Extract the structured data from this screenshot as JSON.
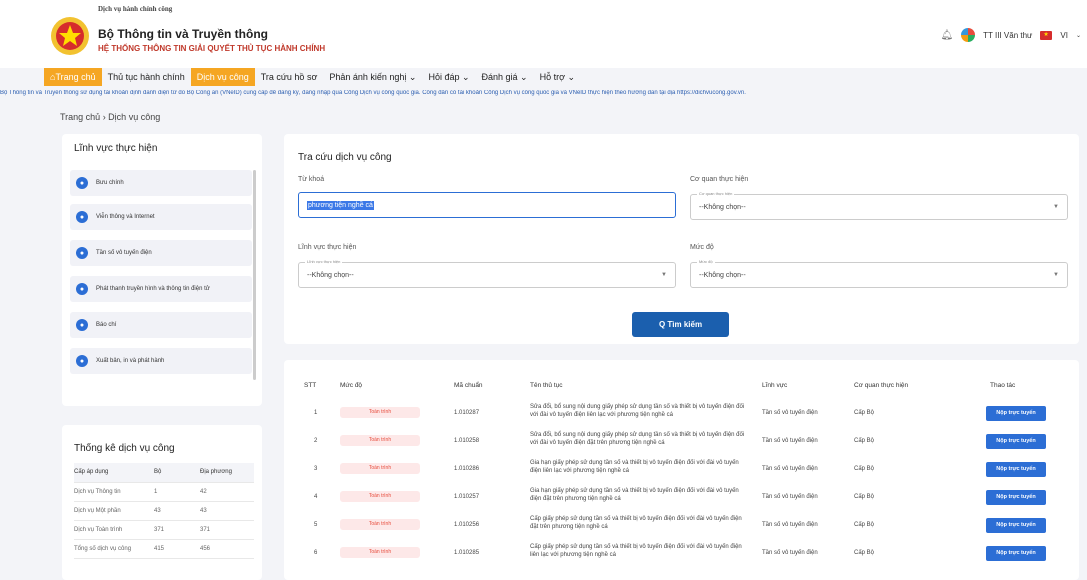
{
  "header": {
    "brand_small": "Dịch vụ hành chính công",
    "brand_big": "Bộ Thông tin và Truyền thông",
    "brand_sub": "HỆ THỐNG THÔNG TIN GIẢI QUYẾT THỦ TỤC HÀNH CHÍNH",
    "user": "TT III Văn thư",
    "lang": "VI"
  },
  "nav": [
    {
      "label": "Trang chủ",
      "active": true
    },
    {
      "label": "Thủ tục hành chính",
      "active": false
    },
    {
      "label": "Dịch vụ công",
      "active": true
    },
    {
      "label": "Tra cứu hồ sơ",
      "active": false
    },
    {
      "label": "Phản ánh kiến nghị ⌄",
      "active": false
    },
    {
      "label": "Hỏi đáp ⌄",
      "active": false
    },
    {
      "label": "Đánh giá ⌄",
      "active": false
    },
    {
      "label": "Hỗ trợ ⌄",
      "active": false
    }
  ],
  "notice": "Bộ Thông tin và Truyền thông sử dụng tài khoản định danh điện tử do Bộ Công an (VNeID) cung cấp để đăng ký, đăng nhập qua Cổng Dịch vụ công quốc gia. Công dân có tài khoản Cổng Dịch vụ công quốc gia và VNeID thực hiện theo hướng dẫn tại địa https://dichvucong.gov.vn.",
  "breadcrumb": "Trang chủ  ›  Dịch vụ công",
  "fields_card": {
    "title": "Lĩnh vực thực hiện",
    "items": [
      "Bưu chính",
      "Viễn thông và Internet",
      "Tần số vô tuyến điện",
      "Phát thanh truyền hình và thông tin điện tử",
      "Báo chí",
      "Xuất bản, in và phát hành"
    ]
  },
  "stats": {
    "title": "Thống kê dịch vụ công",
    "header": [
      "Cấp áp dụng",
      "Bộ",
      "Địa phương"
    ],
    "rows": [
      [
        "Dịch vụ Thông tin",
        "1",
        "42"
      ],
      [
        "Dịch vụ Một phần",
        "43",
        "43"
      ],
      [
        "Dịch vụ Toàn trình",
        "371",
        "371"
      ],
      [
        "Tổng số dịch vụ công",
        "415",
        "456"
      ]
    ]
  },
  "search": {
    "title": "Tra cứu dịch vụ công",
    "keyword_label": "Từ khoá",
    "keyword_value": "phương tiện nghề cá",
    "agency_label": "Cơ quan thực hiện",
    "agency_mini": "Cơ quan thực hiện",
    "agency_value": "--Không chọn--",
    "field_label": "Lĩnh vực thực hiện",
    "field_mini": "Lĩnh vực thực hiện",
    "field_value": "--Không chọn--",
    "level_label": "Mức độ",
    "level_mini": "Mức độ",
    "level_value": "--Không chọn--",
    "button": "Q  Tìm kiếm"
  },
  "table": {
    "headers": [
      "STT",
      "Mức độ",
      "Mã chuẩn",
      "Tên thủ tục",
      "Lĩnh vực",
      "Cơ quan thực hiện",
      "Thao tác"
    ],
    "rows": [
      {
        "stt": "1",
        "level": "Toàn trình",
        "code": "1.010287",
        "name": "Sửa đổi, bổ sung nội dung giấy phép sử dụng tần số và thiết bị vô tuyến điện đối với đài vô tuyến điện liên lạc với phương tiện nghề cá",
        "field": "Tần số vô tuyến điện",
        "org": "Cấp Bộ",
        "action": "Nộp trực tuyến"
      },
      {
        "stt": "2",
        "level": "Toàn trình",
        "code": "1.010258",
        "name": "Sửa đổi, bổ sung nội dung giấy phép sử dụng tần số và thiết bị vô tuyến điện đối với đài vô tuyến điện đặt trên phương tiện nghề cá",
        "field": "Tần số vô tuyến điện",
        "org": "Cấp Bộ",
        "action": "Nộp trực tuyến"
      },
      {
        "stt": "3",
        "level": "Toàn trình",
        "code": "1.010286",
        "name": "Gia hạn giấy phép sử dụng tần số và thiết bị vô tuyến điện đối với đài vô tuyến điện liên lạc với phương tiện nghề cá",
        "field": "Tần số vô tuyến điện",
        "org": "Cấp Bộ",
        "action": "Nộp trực tuyến"
      },
      {
        "stt": "4",
        "level": "Toàn trình",
        "code": "1.010257",
        "name": "Gia hạn giấy phép sử dụng tần số và thiết bị vô tuyến điện đối với đài vô tuyến điện đặt trên phương tiện nghề cá",
        "field": "Tần số vô tuyến điện",
        "org": "Cấp Bộ",
        "action": "Nộp trực tuyến"
      },
      {
        "stt": "5",
        "level": "Toàn trình",
        "code": "1.010256",
        "name": "Cấp giấy phép sử dụng tần số và thiết bị vô tuyến điện đối với đài vô tuyến điện đặt trên phương tiện nghề cá",
        "field": "Tần số vô tuyến điện",
        "org": "Cấp Bộ",
        "action": "Nộp trực tuyến"
      },
      {
        "stt": "6",
        "level": "Toàn trình",
        "code": "1.010285",
        "name": "Cấp giấy phép sử dụng tần số và thiết bị vô tuyến điện đối với đài vô tuyến điện liên lạc với phương tiện nghề cá",
        "field": "Tần số vô tuyến điện",
        "org": "Cấp Bộ",
        "action": "Nộp trực tuyến"
      }
    ]
  }
}
